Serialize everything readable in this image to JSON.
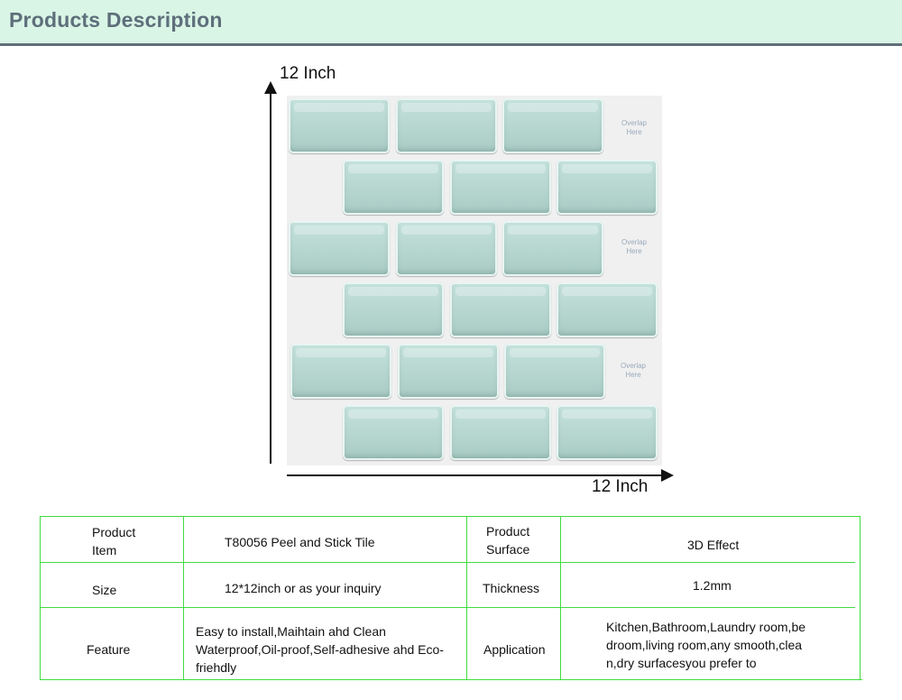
{
  "header": {
    "title": "Products Description"
  },
  "diagram": {
    "height_label": "12 Inch",
    "width_label": "12 Inch",
    "overlap_notes": [
      {
        "line1": "Overlap",
        "line2": "Here"
      },
      {
        "line1": "Overlap",
        "line2": "Here"
      },
      {
        "line1": "Overlap",
        "line2": "Here"
      }
    ]
  },
  "spec_table": {
    "rows": [
      {
        "label1": "Product",
        "label1b": "Item",
        "value1": "T80056 Peel and Stick Tile",
        "label2": "Product",
        "label2b": "Surface",
        "value2": "3D Effect"
      },
      {
        "label1": "Size",
        "value1": "12*12inch or as your inquiry",
        "label2": "Thickness",
        "value2": "1.2mm"
      },
      {
        "label1": "Feature",
        "value1_lines": [
          "Easy to install,Maihtain ahd Clean",
          "Waterproof,Oil-proof,Self-adhesive ahd Eco-",
          "friehdly"
        ],
        "label2": "Application",
        "value2_lines": [
          "Kitchen,Bathroom,Laundry room,be",
          "droom,living room,any smooth,clea",
          "n,dry surfacesyou prefer to"
        ]
      }
    ]
  },
  "colors": {
    "header_bg": "#d9f5e6",
    "header_text": "#5e6f7b",
    "table_border": "#3fdc3f",
    "tile": "#b8d8d1"
  }
}
